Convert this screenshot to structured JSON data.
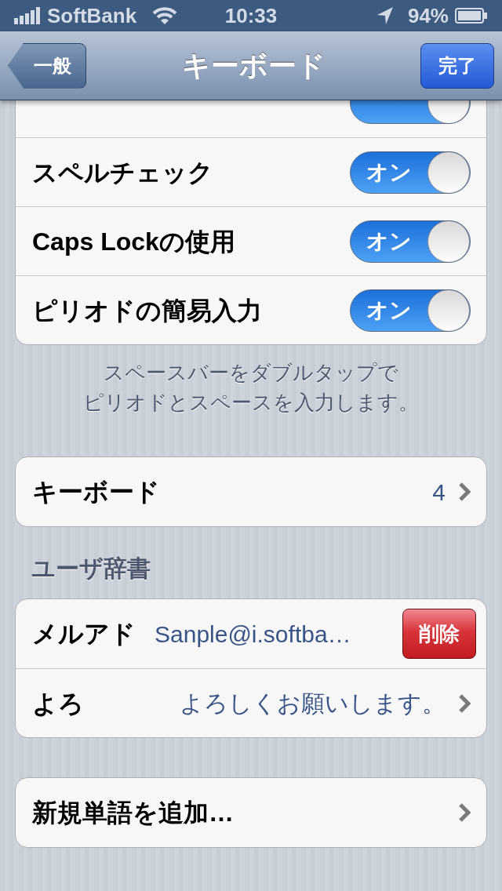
{
  "status_bar": {
    "carrier": "SoftBank",
    "time": "10:33",
    "battery": "94%"
  },
  "nav_bar": {
    "back": "一般",
    "title": "キーボード",
    "done": "完了"
  },
  "groups": [
    {
      "rows": [
        {
          "kind": "toggle",
          "on": true
        },
        {
          "kind": "toggle",
          "label": "スペルチェック",
          "on": true,
          "switch_text": "オン"
        },
        {
          "kind": "toggle",
          "label": "Caps Lockの使用",
          "on": true,
          "switch_text": "オン"
        },
        {
          "kind": "toggle",
          "label": "ピリオドの簡易入力",
          "on": true,
          "switch_text": "オン"
        }
      ],
      "footer": [
        "スペースバーをダブルタップで",
        "ピリオドとスペースを入力します。"
      ]
    },
    {
      "rows": [
        {
          "kind": "link",
          "label": "キーボード",
          "value": "4"
        }
      ]
    },
    {
      "header": "ユーザ辞書",
      "rows": [
        {
          "kind": "delete",
          "label": "メルアド",
          "value": "Sanple@i.softba…",
          "button": "削除"
        },
        {
          "kind": "link",
          "label": "よろ",
          "value": "よろしくお願いします。"
        }
      ]
    },
    {
      "rows": [
        {
          "kind": "link",
          "label": "新規単語を追加…"
        }
      ]
    }
  ]
}
